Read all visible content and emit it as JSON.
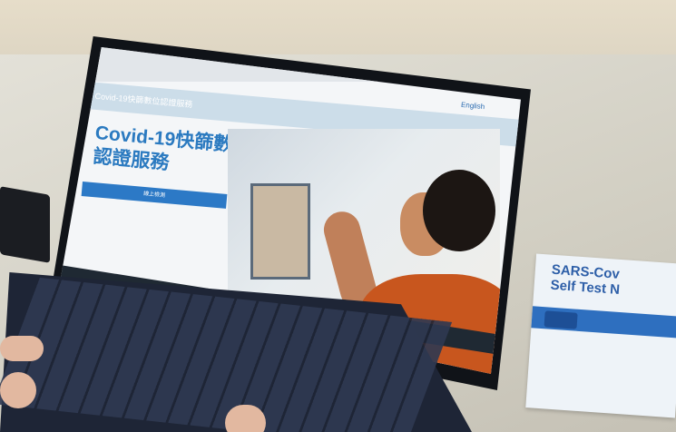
{
  "photo": {
    "site": {
      "logo_text": "Covid-19快篩數位認證服務",
      "title_line1": "Covid-19快篩數位",
      "title_line2": "認證服務",
      "language_link": "English",
      "cta_button": "線上檢測"
    },
    "test_kit": {
      "label_line1": "SARS-Cov",
      "label_line2": "Self Test N"
    }
  }
}
